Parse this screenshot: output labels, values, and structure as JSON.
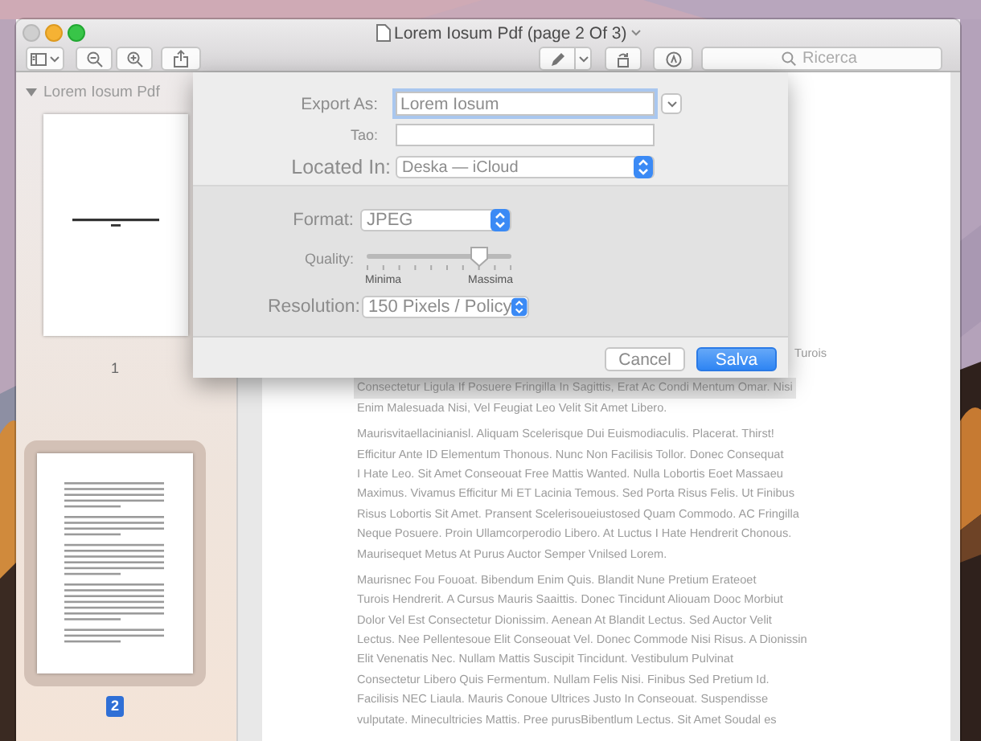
{
  "window": {
    "title": "Lorem Iosum Pdf (page 2 Of 3)"
  },
  "toolbar": {
    "search": {
      "placeholder": "Ricerca"
    }
  },
  "sidebar": {
    "title": "Lorem Iosum Pdf",
    "expanded": true,
    "pages": [
      {
        "label": "1",
        "kind": "title",
        "selected": false
      },
      {
        "label": "2",
        "kind": "text",
        "selected": true
      }
    ]
  },
  "document": {
    "paragraphs": [
      {
        "lines": [
          {
            "text": "Turois",
            "highlighted": false
          }
        ]
      },
      {
        "lines": [
          {
            "text": "Consectetur Ligula If Posuere Fringilla In Sagittis, Erat Ac Condi Mentum Omar. Nisi",
            "highlighted": true
          },
          {
            "text": "Enim Malesuada Nisi, Vel Feugiat Leo Velit Sit Amet Libero.",
            "highlighted": false
          }
        ]
      },
      {
        "lines": [
          {
            "text": "Maurisvitaellacinianisl. Aliquam Scelerisque Dui Euismodiaculis. Placerat. Thirst!",
            "highlighted": false
          },
          {
            "text": "Efficitur Ante ID Elementum Thonous. Nunc Non Facilisis Tollor. Donec Consequat",
            "highlighted": false
          },
          {
            "text": "I Hate Leo. Sit Amet Conseouat Free Mattis Wanted. Nulla Lobortis Eoet Massaeu",
            "highlighted": false
          },
          {
            "text": "Maximus. Vivamus Efficitur Mi ET Lacinia Temous. Sed Porta Risus Felis. Ut Finibus",
            "highlighted": false
          },
          {
            "text": "Risus Lobortis Sit Amet. Pransent Scelerisoueiustosed Quam Commodo. AC Fringilla",
            "highlighted": false
          },
          {
            "text": "Neque Posuere. Proin Ullamcorperodio Libero. At Luctus I Hate Hendrerit Chonous.",
            "highlighted": false
          },
          {
            "text": "Maurisequet Metus At Purus Auctor Semper Vnilsed Lorem.",
            "highlighted": false
          }
        ]
      },
      {
        "lines": [
          {
            "text": "Maurisnec Fou Fouoat. Bibendum Enim Quis. Blandit Nune Pretium Erateoet",
            "highlighted": false
          },
          {
            "text": "Turois Hendrerit. A Cursus Mauris Saaittis. Donec Tincidunt Aliouam Dooc Morbiut",
            "highlighted": false
          },
          {
            "text": "Dolor Vel Est Consectetur Dionissim. Aenean At Blandit Lectus. Sed Auctor Velit",
            "highlighted": false
          },
          {
            "text": "Lectus. Nee Pellentesoue Elit Conseouat Vel. Donec Commode Nisi Risus. A Dionissin",
            "highlighted": false
          },
          {
            "text": "Elit Venenatis Nec. Nullam Mattis Suscipit Tincidunt. Vestibulum Pulvinat",
            "highlighted": false
          },
          {
            "text": "Consectetur Libero Quis Fermentum. Nullam Felis Nisi. Finibus Sed Pretium Id.",
            "highlighted": false
          },
          {
            "text": "Facilisis NEC Liaula. Mauris Conoue Ultrices Justo In Conseouat. Suspendisse",
            "highlighted": false
          },
          {
            "text": "vulputate. Minecultricies Mattis. Pree purusBibentlum Lectus. Sit Amet Soudal es",
            "highlighted": false
          }
        ]
      }
    ]
  },
  "export_sheet": {
    "export_as": {
      "label": "Export As:",
      "value": "Lorem Iosum"
    },
    "tag": {
      "label": "Tao:"
    },
    "location": {
      "label": "Located In:",
      "value": "Deska — iCloud"
    },
    "format": {
      "label": "Format:",
      "value": "JPEG"
    },
    "quality": {
      "label": "Quality:",
      "level": 0.78,
      "min_label": "Minima",
      "max_label": "Massima"
    },
    "resolution": {
      "label": "Resolution:",
      "value": "150 Pixels / Policy"
    },
    "buttons": [
      {
        "label": "Cancel",
        "kind": "secondary"
      },
      {
        "label": "Salva",
        "kind": "primary"
      }
    ]
  }
}
